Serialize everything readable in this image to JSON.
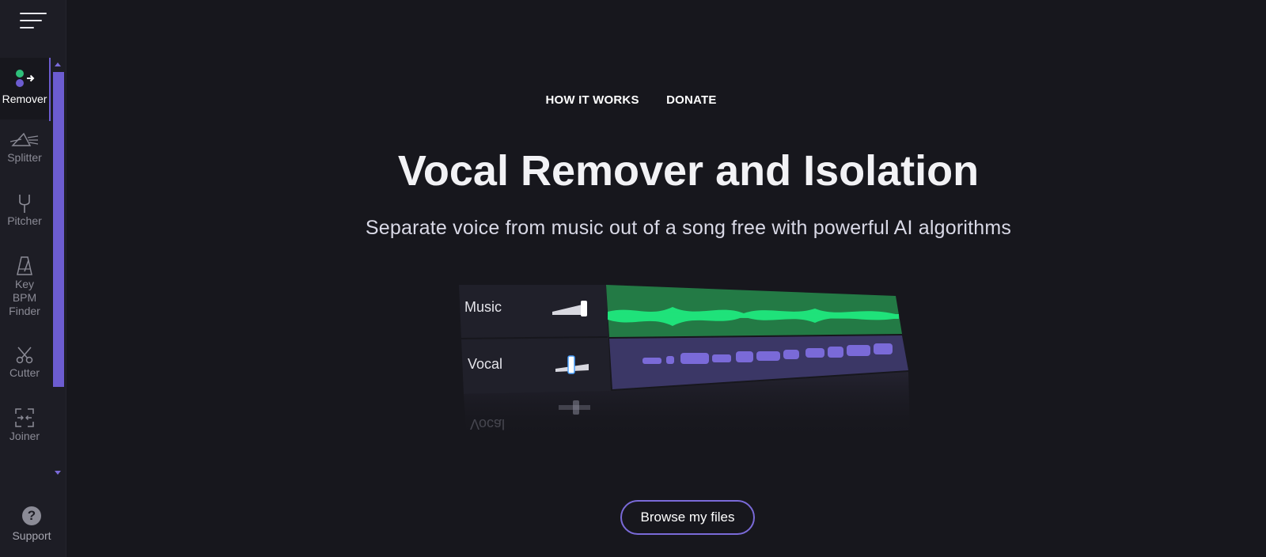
{
  "sidebar": {
    "menu_icon": "hamburger-icon",
    "tools": [
      {
        "id": "remover",
        "label": "Remover",
        "icon": "remover-dots-arrow-icon",
        "active": true
      },
      {
        "id": "splitter",
        "label": "Splitter",
        "icon": "prism-icon"
      },
      {
        "id": "pitcher",
        "label": "Pitcher",
        "icon": "tuning-fork-icon"
      },
      {
        "id": "key-bpm",
        "label": "Key\nBPM\nFinder",
        "icon": "metronome-icon"
      },
      {
        "id": "cutter",
        "label": "Cutter",
        "icon": "scissors-icon"
      },
      {
        "id": "joiner",
        "label": "Joiner",
        "icon": "joiner-icon"
      }
    ],
    "support": {
      "label": "Support",
      "icon": "question-icon",
      "glyph": "?"
    }
  },
  "nav": {
    "how_it_works": "HOW IT WORKS",
    "donate": "DONATE"
  },
  "hero": {
    "title": "Vocal Remover and Isolation",
    "subtitle": "Separate voice from music out of a song free with powerful AI algorithms"
  },
  "tracks": {
    "music": "Music",
    "vocal": "Vocal",
    "reflection": "Vocal"
  },
  "colors": {
    "accent": "#6c5cd0",
    "music_wave": "#1fe27a",
    "vocal_wave": "#7a6ad8"
  },
  "cta": {
    "browse": "Browse my files"
  }
}
